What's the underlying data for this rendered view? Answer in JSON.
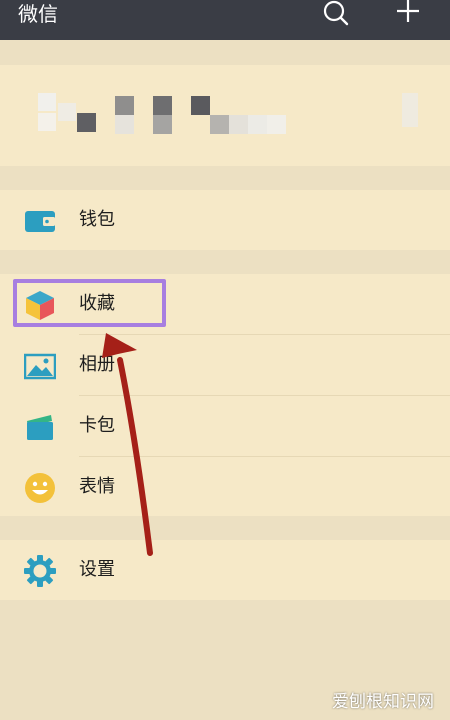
{
  "header": {
    "title": "微信",
    "search_icon": "search-icon",
    "add_icon": "plus-icon"
  },
  "menu": {
    "wallet": {
      "label": "钱包",
      "icon": "wallet-icon"
    },
    "favorites": {
      "label": "收藏",
      "icon": "cube-icon"
    },
    "album": {
      "label": "相册",
      "icon": "image-icon"
    },
    "card_wallet": {
      "label": "卡包",
      "icon": "card-icon"
    },
    "stickers": {
      "label": "表情",
      "icon": "smiley-icon"
    },
    "settings": {
      "label": "设置",
      "icon": "gear-icon"
    }
  },
  "annotation": {
    "highlight_color": "#a77ee0",
    "arrow_color": "#a52018"
  },
  "watermark": "爱刨根知识网",
  "colors": {
    "header_bg": "#3a3d45",
    "page_bg": "#ece0c2",
    "card_bg": "#f6e9c8"
  }
}
